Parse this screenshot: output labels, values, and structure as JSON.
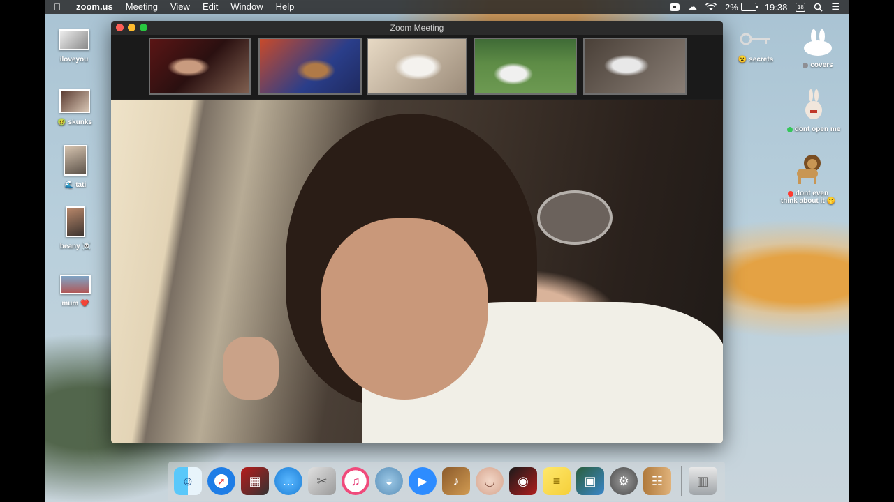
{
  "menubar": {
    "apple": "",
    "app_name": "zoom.us",
    "menus": [
      "Meeting",
      "View",
      "Edit",
      "Window",
      "Help"
    ],
    "battery": "2%",
    "time": "19:38",
    "calendar_day": "18",
    "status_icons": [
      "zoom-camera-icon",
      "creative-cloud-icon",
      "wifi-icon",
      "battery-icon",
      "calendar-icon",
      "search-icon",
      "control-center-icon"
    ]
  },
  "desktop": {
    "left_items": [
      {
        "label": "iloveyou",
        "badge": ""
      },
      {
        "label": "skunks",
        "badge": "🤢"
      },
      {
        "label": "tati",
        "badge": "🌊"
      },
      {
        "label": "beany",
        "badge": "☠️"
      },
      {
        "label": "mum",
        "badge": "❤️"
      }
    ],
    "right_items": [
      {
        "label": "secrets",
        "badge": "😮"
      },
      {
        "label": "covers",
        "badge": ""
      },
      {
        "label": "dont open me",
        "badge": ""
      },
      {
        "label_line1": "dont even",
        "label_line2": "think about it",
        "badge": "🤫"
      }
    ],
    "tag_colors": {
      "covers": "#8e8e93",
      "dont_open_me": "#34c759",
      "dont_even": "#ff3b30"
    }
  },
  "zoom": {
    "window_title": "Zoom Meeting",
    "participants": [
      "participant-1",
      "participant-2",
      "participant-3",
      "participant-4",
      "participant-5"
    ]
  },
  "dock": {
    "apps": [
      "Finder",
      "Safari",
      "Photo Booth",
      "Messages",
      "Grab",
      "iTunes",
      "Sequel Pro",
      "zoom.us",
      "GarageBand",
      "Face App",
      "Photo Editor",
      "Stickies",
      "Preview",
      "System Preferences",
      "Contacts",
      "Trash"
    ]
  }
}
